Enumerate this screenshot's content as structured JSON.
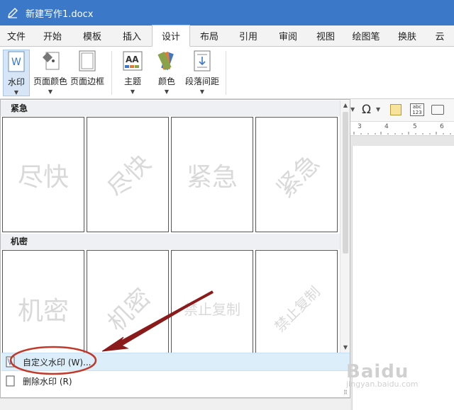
{
  "window": {
    "title": "新建写作1.docx"
  },
  "tabs": [
    {
      "label": "文件"
    },
    {
      "label": "开始"
    },
    {
      "label": "模板"
    },
    {
      "label": "插入"
    },
    {
      "label": "设计",
      "active": true
    },
    {
      "label": "布局"
    },
    {
      "label": "引用"
    },
    {
      "label": "审阅"
    },
    {
      "label": "视图"
    },
    {
      "label": "绘图笔"
    },
    {
      "label": "换肤"
    },
    {
      "label": "云"
    }
  ],
  "ribbon": {
    "watermark": "水印",
    "page_color": "页面颜色",
    "page_border": "页面边框",
    "theme": "主题",
    "colors": "颜色",
    "paragraph_spacing": "段落间距"
  },
  "toolbar_right": {
    "omega": "Ω",
    "abc_label": "abc"
  },
  "ruler": {
    "ticks": [
      "3",
      "4",
      "5",
      "6"
    ]
  },
  "panel": {
    "sections": [
      {
        "header": "紧急",
        "items": [
          "尽快",
          "尽快",
          "紧急",
          "紧急"
        ]
      },
      {
        "header": "机密",
        "items": [
          "机密",
          "机密",
          "禁止复制",
          "禁止复制"
        ]
      }
    ],
    "menu": {
      "custom": "自定义水印 (W)...",
      "remove": "删除水印 (R)"
    }
  },
  "colors": {
    "titlebar": "#3c78c8",
    "annotation": "#c0392b",
    "arrow": "#8b1a1a"
  },
  "logo": {
    "brand": "Baidu",
    "sub": "jingyan.baidu.com"
  }
}
